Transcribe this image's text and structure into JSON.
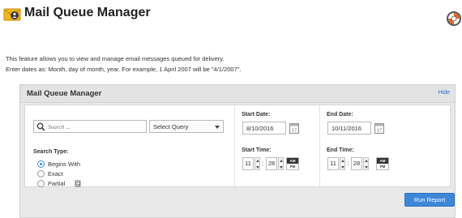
{
  "page": {
    "title": "Mail Queue Manager",
    "icon": "mail-queue-icon",
    "help_icon": "help-lifebuoy-icon",
    "description_line1": "This feature allows you to view and manage email messages queued for delivery.",
    "description_line2": "Enter dates as: Month, day of month, year. For example, 1 April 2007 will be \"4/1/2007\"."
  },
  "panel": {
    "title": "Mail Queue Manager",
    "hide_link": "Hide",
    "search": {
      "placeholder": "Search ...",
      "value": "",
      "icon": "search-icon"
    },
    "query_select": {
      "selected": "Select Query"
    },
    "search_type": {
      "label": "Search Type:",
      "options": [
        {
          "label": "Begins With",
          "checked": true
        },
        {
          "label": "Exact",
          "checked": false
        },
        {
          "label": "Partial",
          "checked": false
        }
      ]
    },
    "start_date": {
      "label": "Start Date:",
      "value": "8/10/2016",
      "calendar_day": "17"
    },
    "end_date": {
      "label": "End Date:",
      "value": "10/11/2016",
      "calendar_day": "17"
    },
    "start_time": {
      "label": "Start Time:",
      "hour": "11",
      "minute": "28",
      "am": "AM",
      "pm": "PM",
      "selected_period": "AM"
    },
    "end_time": {
      "label": "End Time:",
      "hour": "11",
      "minute": "28",
      "am": "AM",
      "pm": "PM",
      "selected_period": "AM"
    },
    "run_button": "Run Report"
  },
  "colors": {
    "accent": "#3d86d8",
    "link": "#2f6fd1",
    "panel_bg": "#e9e9e9"
  }
}
